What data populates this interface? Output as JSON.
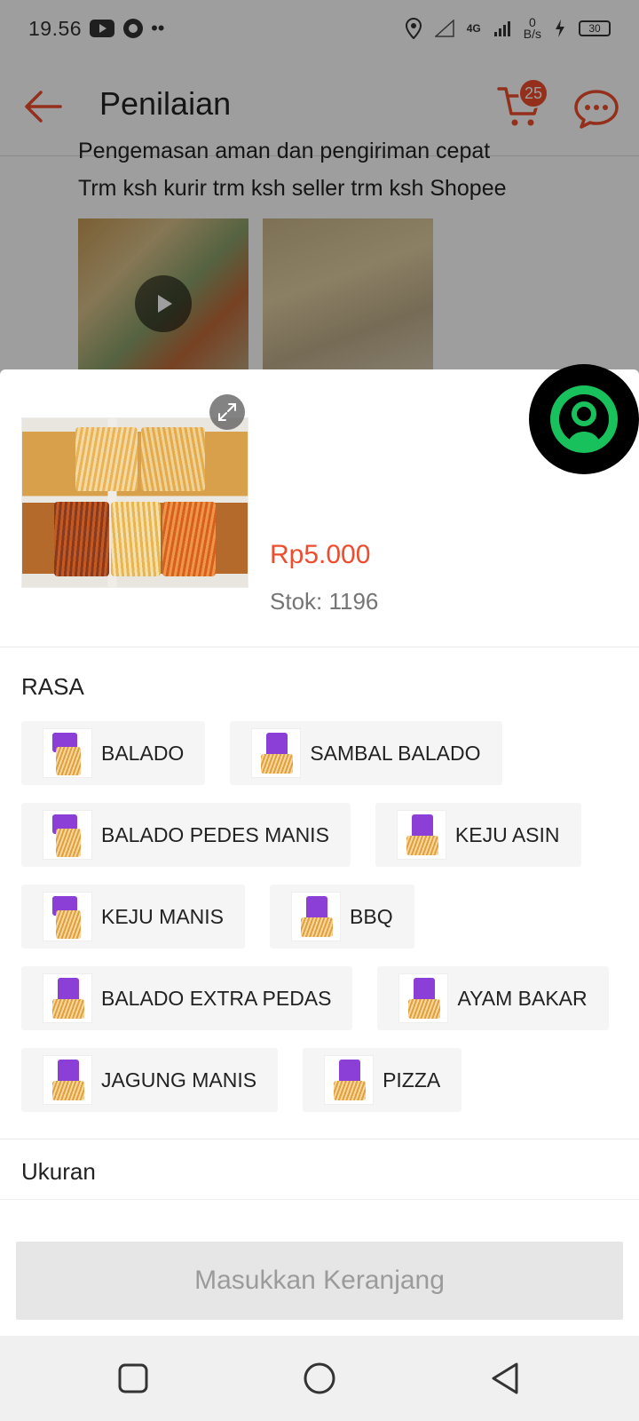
{
  "status_bar": {
    "time": "19.56",
    "network": "4G",
    "speed_value": "0",
    "speed_unit": "B/s",
    "battery": "30"
  },
  "app_bar": {
    "title": "Penilaian",
    "cart_count": "25"
  },
  "review": {
    "line1": "Pengemasan aman dan pengiriman cepat",
    "line2": "Trm ksh kurir trm ksh seller trm ksh Shopee"
  },
  "product": {
    "price": "Rp5.000",
    "stock": "Stok: 1196"
  },
  "variation": {
    "title": "RASA",
    "rows": [
      [
        "BALADO",
        "SAMBAL BALADO"
      ],
      [
        "BALADO PEDES MANIS",
        "KEJU ASIN"
      ],
      [
        "KEJU MANIS",
        "BBQ"
      ],
      [
        "BALADO EXTRA PEDAS",
        "AYAM BAKAR"
      ],
      [
        "JAGUNG MANIS",
        "PIZZA"
      ]
    ]
  },
  "size_section": {
    "title": "Ukuran"
  },
  "footer": {
    "add_to_cart_label": "Masukkan Keranjang"
  },
  "colors": {
    "accent": "#ee4d2d",
    "disabled_button": "#e6e6e6",
    "chip_bg": "#f5f5f5"
  }
}
